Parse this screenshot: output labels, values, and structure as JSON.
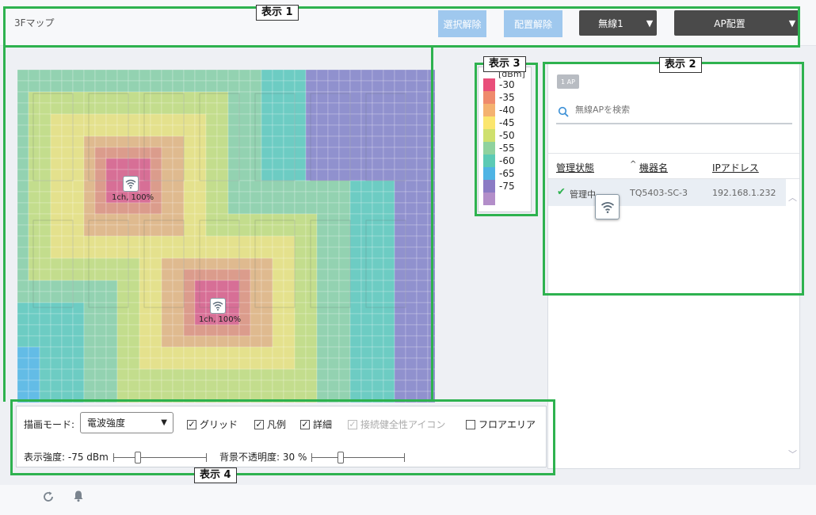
{
  "header": {
    "map_title": "3Fマップ",
    "deselect_label": "選択解除",
    "unplace_label": "配置解除",
    "wireless_select": "無線1",
    "ap_place_select": "AP配置"
  },
  "map": {
    "aps": [
      {
        "label": "1ch, 100%"
      },
      {
        "label": "1ch, 100%"
      }
    ]
  },
  "legend": {
    "unit": "[dBm]",
    "entries": [
      {
        "value": "-30",
        "color": "#e94e7a"
      },
      {
        "value": "-35",
        "color": "#ef8a6c"
      },
      {
        "value": "-40",
        "color": "#f4b270"
      },
      {
        "value": "-45",
        "color": "#fbe66e"
      },
      {
        "value": "-50",
        "color": "#cfe06e"
      },
      {
        "value": "-55",
        "color": "#8fd29e"
      },
      {
        "value": "-60",
        "color": "#5ccab5"
      },
      {
        "value": "-65",
        "color": "#4fb4e4"
      },
      {
        "value": "-75",
        "color": "#8b7bc4"
      },
      {
        "value": "",
        "color": "#b38ec9"
      }
    ]
  },
  "ap_panel": {
    "count_badge": "1 AP",
    "search_placeholder": "無線APを検索",
    "columns": {
      "status": "管理状態",
      "name": "機器名",
      "ip": "IPアドレス"
    },
    "rows": [
      {
        "status": "管理中",
        "name": "TQ5403-SC-3",
        "ip": "192.168.1.232"
      }
    ]
  },
  "options": {
    "mode_label": "描画モード:",
    "mode_value": "電波強度",
    "grid_label": "グリッド",
    "legend_label": "凡例",
    "detail_label": "詳細",
    "health_icon_label": "接続健全性アイコン",
    "floor_area_label": "フロアエリア",
    "grid_checked": true,
    "legend_checked": true,
    "detail_checked": true,
    "health_icon_checked": true,
    "floor_area_checked": false,
    "strength_label": "表示強度: -75 dBm",
    "strength_value": 0.25,
    "opacity_label": "背景不透明度: 30 %",
    "opacity_value": 0.3
  },
  "annotations": {
    "a1": "表示 1",
    "a2": "表示 2",
    "a3": "表示 3",
    "a4": "表示 4"
  },
  "colors": {
    "annotation_green": "#2eb24f",
    "button_light": "#9fc8ee",
    "button_dark": "#4a4a4a"
  }
}
